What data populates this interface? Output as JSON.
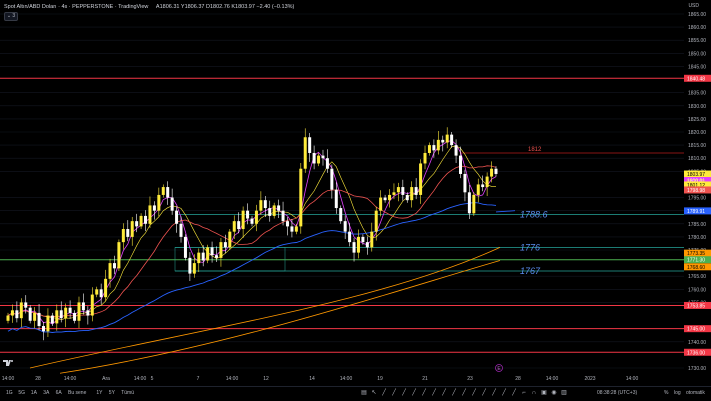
{
  "header": {
    "title": "Spot Altın/ABD Doları · 4s · PEPPERSTONE · TradingView",
    "ohlc": "A1806.31 Y1806.37 D1802.76 K1803.97 −2.40 (−0.13%)",
    "collapse_label": "⌄ 3"
  },
  "currency": "USD",
  "price_axis": {
    "labels": [
      "1865.00",
      "1860.00",
      "1855.00",
      "1850.00",
      "1845.00",
      "1835.00",
      "1830.00",
      "1825.00",
      "1820.00",
      "1815.00",
      "1810.00",
      "1805.00",
      "1795.00",
      "1790.00",
      "1785.00",
      "1780.00",
      "1775.00",
      "1765.00",
      "1760.00",
      "1755.00",
      "1745.00",
      "1740.00",
      "1730.00"
    ],
    "badges": [
      {
        "text": "1840.48",
        "color": "#f23645"
      },
      {
        "text": "1803.97",
        "color": "#ffeb3b"
      },
      {
        "text": "1800.01",
        "color": "#e040fb"
      },
      {
        "text": "1801.12",
        "color": "#ffeb3b"
      },
      {
        "text": "1798.98",
        "color": "#ef5350"
      },
      {
        "text": "1789.91",
        "color": "#2962ff"
      },
      {
        "text": "1773.35",
        "color": "#ff9800"
      },
      {
        "text": "1771.30",
        "color": "#4caf50"
      },
      {
        "text": "1768.60",
        "color": "#ff9800"
      },
      {
        "text": "1753.85",
        "color": "#f23645"
      },
      {
        "text": "1745.00",
        "color": "#f23645"
      },
      {
        "text": "1736.00",
        "color": "#f23645"
      }
    ],
    "countdown": "01:21:10"
  },
  "annotations": [
    "1812",
    "1788.6",
    "1776",
    "1767"
  ],
  "time_axis": [
    "14:00",
    "28",
    "14:00",
    "Ara",
    "14:00",
    "5",
    "7",
    "14:00",
    "12",
    "14",
    "14:00",
    "19",
    "21",
    "23",
    "28",
    "14:00",
    "2023",
    "14:00"
  ],
  "bottom": {
    "timeframes": [
      "1G",
      "5G",
      "1A",
      "3A",
      "6A",
      "Bu sene",
      "1Y",
      "5Y",
      "Tümü"
    ],
    "clock": "08:38:28 (UTC+3)",
    "pct": "%",
    "log": "log",
    "auto": "otomatik"
  },
  "colors": {
    "up": "#ffeb3b",
    "down": "#ffffff",
    "ma_fast": "#e040fb",
    "ma_mid": "#ef5350",
    "ma_blue": "#2962ff",
    "ma_orange": "#ff9800",
    "hline_red": "#f23645",
    "hline_green": "#4caf50"
  }
}
